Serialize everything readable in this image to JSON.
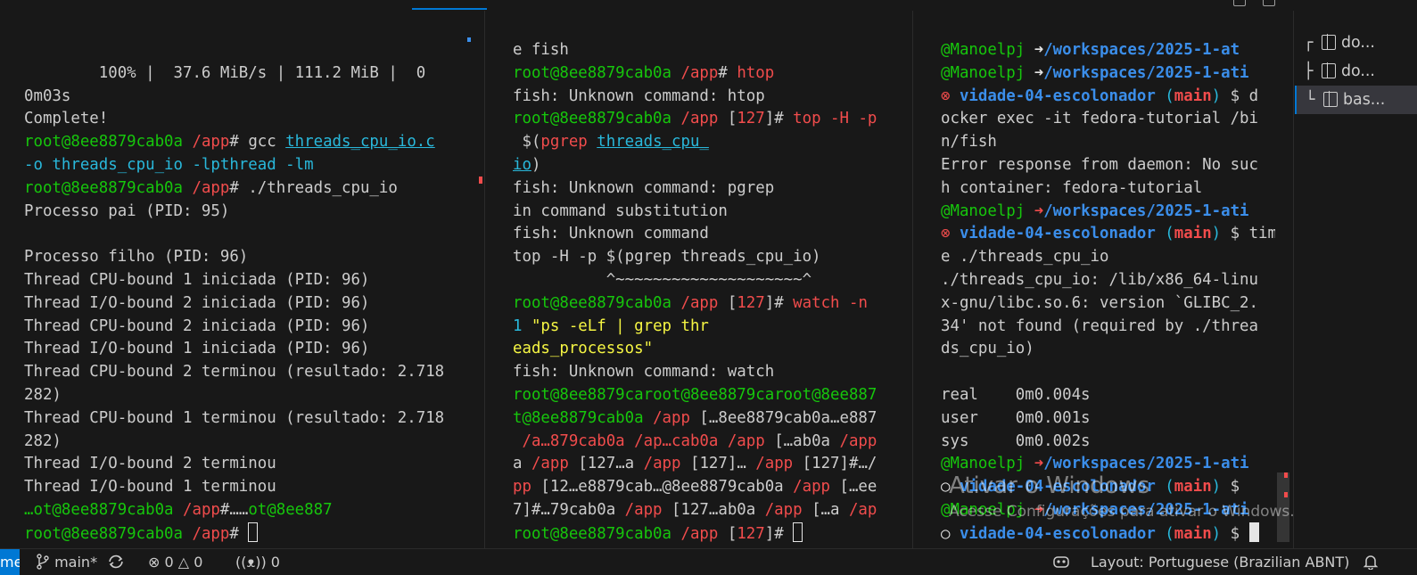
{
  "pane1": {
    "lines": [
      [
        {
          "t": ""
        }
      ],
      [
        {
          "t": "        100% |  37.6 MiB/s | 111.2 MiB |  0"
        }
      ],
      [
        {
          "t": "0m03s"
        }
      ],
      [
        {
          "t": "Complete!"
        }
      ],
      [
        {
          "t": "root",
          "c": "g"
        },
        {
          "t": "@8ee8879cab0a ",
          "c": "g"
        },
        {
          "t": "/app",
          "c": "r"
        },
        {
          "t": "# gcc "
        },
        {
          "t": "threads_cpu_io.c",
          "c": "c u"
        }
      ],
      [
        {
          "t": "-o threads_cpu_io -lpthread -lm",
          "c": "c"
        }
      ],
      [
        {
          "t": "root",
          "c": "g"
        },
        {
          "t": "@8ee8879cab0a ",
          "c": "g"
        },
        {
          "t": "/app",
          "c": "r"
        },
        {
          "t": "# ./threads_cpu_io"
        }
      ],
      [
        {
          "t": "Processo pai (PID: 95)"
        }
      ],
      [
        {
          "t": ""
        }
      ],
      [
        {
          "t": "Processo filho (PID: 96)"
        }
      ],
      [
        {
          "t": "Thread CPU-bound 1 iniciada (PID: 96)"
        }
      ],
      [
        {
          "t": "Thread I/O-bound 2 iniciada (PID: 96)"
        }
      ],
      [
        {
          "t": "Thread CPU-bound 2 iniciada (PID: 96)"
        }
      ],
      [
        {
          "t": "Thread I/O-bound 1 iniciada (PID: 96)"
        }
      ],
      [
        {
          "t": "Thread CPU-bound 2 terminou (resultado: 2.718"
        }
      ],
      [
        {
          "t": "282)"
        }
      ],
      [
        {
          "t": "Thread CPU-bound 1 terminou (resultado: 2.718"
        }
      ],
      [
        {
          "t": "282)"
        }
      ],
      [
        {
          "t": "Thread I/O-bound 2 terminou"
        }
      ],
      [
        {
          "t": "Thread I/O-bound 1 terminou"
        }
      ],
      [
        {
          "t": "…ot@8ee8879cab0a ",
          "c": "g"
        },
        {
          "t": "/app",
          "c": "r"
        },
        {
          "t": "#……"
        },
        {
          "t": "ot@8ee887",
          "c": "g"
        }
      ],
      [
        {
          "t": "root",
          "c": "g"
        },
        {
          "t": "@8ee8879cab0a ",
          "c": "g"
        },
        {
          "t": "/app",
          "c": "r"
        },
        {
          "t": "# "
        },
        {
          "cursor": "hollow"
        }
      ]
    ]
  },
  "pane2": {
    "lines": [
      [
        {
          "t": "e fish"
        }
      ],
      [
        {
          "t": "root",
          "c": "g"
        },
        {
          "t": "@8ee8879cab0a ",
          "c": "g"
        },
        {
          "t": "/app",
          "c": "r"
        },
        {
          "t": "# "
        },
        {
          "t": "htop",
          "c": "r"
        }
      ],
      [
        {
          "t": "fish: Unknown command: htop"
        }
      ],
      [
        {
          "t": "root",
          "c": "g"
        },
        {
          "t": "@8ee8879cab0a ",
          "c": "g"
        },
        {
          "t": "/app ",
          "c": "r"
        },
        {
          "t": "["
        },
        {
          "t": "127",
          "c": "r"
        },
        {
          "t": "]# "
        },
        {
          "t": "top -H -p",
          "c": "r"
        }
      ],
      [
        {
          "t": " $("
        },
        {
          "t": "pgrep",
          "c": "r"
        },
        {
          "t": " "
        },
        {
          "t": "threads_cpu_",
          "c": "c u"
        }
      ],
      [
        {
          "t": "io",
          "c": "c u"
        },
        {
          "t": ")"
        }
      ],
      [
        {
          "t": "fish: Unknown command: pgrep"
        }
      ],
      [
        {
          "t": "in command substitution"
        }
      ],
      [
        {
          "t": "fish: Unknown command"
        }
      ],
      [
        {
          "t": "top -H -p $(pgrep threads_cpu_io)"
        }
      ],
      [
        {
          "t": "          ^~~~~~~~~~~~~~~~~~~~~^"
        }
      ],
      [
        {
          "t": "root",
          "c": "g"
        },
        {
          "t": "@8ee8879cab0a ",
          "c": "g"
        },
        {
          "t": "/app ",
          "c": "r"
        },
        {
          "t": "["
        },
        {
          "t": "127",
          "c": "r"
        },
        {
          "t": "]# "
        },
        {
          "t": "watch -n",
          "c": "r"
        }
      ],
      [
        {
          "t": "1 ",
          "c": "c"
        },
        {
          "t": "\"ps -eLf | grep thr",
          "c": "y"
        }
      ],
      [
        {
          "t": "eads_processos\"",
          "c": "y"
        }
      ],
      [
        {
          "t": "fish: Unknown command: watch"
        }
      ],
      [
        {
          "t": "root",
          "c": "g"
        },
        {
          "t": "@8ee8879ca",
          "c": "g"
        },
        {
          "t": "root",
          "c": "g"
        },
        {
          "t": "@8ee8879ca",
          "c": "g"
        },
        {
          "t": "root",
          "c": "g"
        },
        {
          "t": "@8ee887",
          "c": "g"
        }
      ],
      [
        {
          "t": "t@8ee8879cab0a ",
          "c": "g"
        },
        {
          "t": "/app ",
          "c": "r"
        },
        {
          "t": "[…8ee8879cab0a…e887"
        }
      ],
      [
        {
          "t": " /a…879cab0a ",
          "c": "r"
        },
        {
          "t": "/ap…cab0a ",
          "c": "r"
        },
        {
          "t": "/app ",
          "c": "r"
        },
        {
          "t": "[…ab0a "
        },
        {
          "t": "/app",
          "c": "r"
        }
      ],
      [
        {
          "t": "a "
        },
        {
          "t": "/app ",
          "c": "r"
        },
        {
          "t": "[127…a "
        },
        {
          "t": "/app ",
          "c": "r"
        },
        {
          "t": "[127]… "
        },
        {
          "t": "/app ",
          "c": "r"
        },
        {
          "t": "[127]#…/"
        }
      ],
      [
        {
          "t": "pp ",
          "c": "r"
        },
        {
          "t": "[12…e8879cab…@8ee8879cab0a "
        },
        {
          "t": "/app ",
          "c": "r"
        },
        {
          "t": "[…ee"
        }
      ],
      [
        {
          "t": "7]#…79cab0a "
        },
        {
          "t": "/app ",
          "c": "r"
        },
        {
          "t": "[127…ab0a "
        },
        {
          "t": "/app ",
          "c": "r"
        },
        {
          "t": "[…a "
        },
        {
          "t": "/ap",
          "c": "r"
        }
      ],
      [
        {
          "t": "root",
          "c": "g"
        },
        {
          "t": "@8ee8879cab0a ",
          "c": "g"
        },
        {
          "t": "/app ",
          "c": "r"
        },
        {
          "t": "["
        },
        {
          "t": "127",
          "c": "r"
        },
        {
          "t": "]# "
        },
        {
          "cursor": "hollow"
        }
      ]
    ]
  },
  "pane3": {
    "lines": [
      [
        {
          "t": "@Manoelpj ",
          "c": "g"
        },
        {
          "t": "➜",
          "c": "w"
        },
        {
          "t": "/workspaces/2025-1-at",
          "c": "b bold"
        }
      ],
      [
        {
          "t": "@Manoelpj ",
          "c": "g"
        },
        {
          "t": "➜",
          "c": "w"
        },
        {
          "t": "/workspaces/2025-1-ati",
          "c": "b bold"
        }
      ],
      [
        {
          "t": "⊗ ",
          "c": "r"
        },
        {
          "t": "vidade-04-escolonador ",
          "c": "b bold"
        },
        {
          "t": "(",
          "c": "c"
        },
        {
          "t": "main",
          "c": "r bold"
        },
        {
          "t": ") ",
          "c": "c"
        },
        {
          "t": "$ d"
        }
      ],
      [
        {
          "t": "ocker exec -it fedora-tutorial /bi"
        }
      ],
      [
        {
          "t": "n/fish"
        }
      ],
      [
        {
          "t": "Error response from daemon: No suc"
        }
      ],
      [
        {
          "t": "h container: fedora-tutorial"
        }
      ],
      [
        {
          "t": "@Manoelpj ",
          "c": "g"
        },
        {
          "t": "➜",
          "c": "r"
        },
        {
          "t": "/workspaces/2025-1-ati",
          "c": "b bold"
        }
      ],
      [
        {
          "t": "⊗ ",
          "c": "r"
        },
        {
          "t": "vidade-04-escolonador ",
          "c": "b bold"
        },
        {
          "t": "(",
          "c": "c"
        },
        {
          "t": "main",
          "c": "r bold"
        },
        {
          "t": ") ",
          "c": "c"
        },
        {
          "t": "$ tim"
        }
      ],
      [
        {
          "t": "e ./threads_cpu_io"
        }
      ],
      [
        {
          "t": "./threads_cpu_io: /lib/x86_64-linu"
        }
      ],
      [
        {
          "t": "x-gnu/libc.so.6: version `GLIBC_2."
        }
      ],
      [
        {
          "t": "34' not found (required by ./threa"
        }
      ],
      [
        {
          "t": "ds_cpu_io)"
        }
      ],
      [
        {
          "t": ""
        }
      ],
      [
        {
          "t": "real    0m0.004s"
        }
      ],
      [
        {
          "t": "user    0m0.001s"
        }
      ],
      [
        {
          "t": "sys     0m0.002s"
        }
      ],
      [
        {
          "t": "@Manoelpj ",
          "c": "g"
        },
        {
          "t": "➜",
          "c": "r"
        },
        {
          "t": "/workspaces/2025-1-ati",
          "c": "b bold"
        }
      ],
      [
        {
          "t": "○ ",
          "c": "w"
        },
        {
          "t": "vidade-04-escolonador ",
          "c": "b bold"
        },
        {
          "t": "(",
          "c": "c"
        },
        {
          "t": "main",
          "c": "r bold"
        },
        {
          "t": ") ",
          "c": "c"
        },
        {
          "t": "$ "
        }
      ],
      [
        {
          "t": "@Manoelpj ",
          "c": "g"
        },
        {
          "t": "➜",
          "c": "r"
        },
        {
          "t": "/workspaces/2025-1-ati",
          "c": "b bold"
        }
      ],
      [
        {
          "t": "○ ",
          "c": "w"
        },
        {
          "t": "vidade-04-escolonador ",
          "c": "b bold"
        },
        {
          "t": "(",
          "c": "c"
        },
        {
          "t": "main",
          "c": "r bold"
        },
        {
          "t": ") ",
          "c": "c"
        },
        {
          "t": "$ "
        },
        {
          "cursor": "solid"
        }
      ]
    ]
  },
  "sidebar": {
    "items": [
      {
        "tree": "┌",
        "label": "do..."
      },
      {
        "tree": "├",
        "label": "do..."
      },
      {
        "tree": "└",
        "label": "bas..."
      }
    ]
  },
  "watermark": {
    "title": "Ativar o Windows",
    "subtitle": "Acesse Configurações para ativar o Windows."
  },
  "statusbar": {
    "remote_label": "me",
    "branch": "main*",
    "errors": "0",
    "warnings": "0",
    "ports": "0",
    "layout": "Layout: Portuguese (Brazilian ABNT)"
  },
  "colors": {
    "accent": "#0078d4",
    "prompt_green": "#16c60c",
    "path_red": "#f14c4c",
    "path_blue": "#3b8eea",
    "string_yellow": "#f5f543",
    "arg_cyan": "#29b8db"
  }
}
